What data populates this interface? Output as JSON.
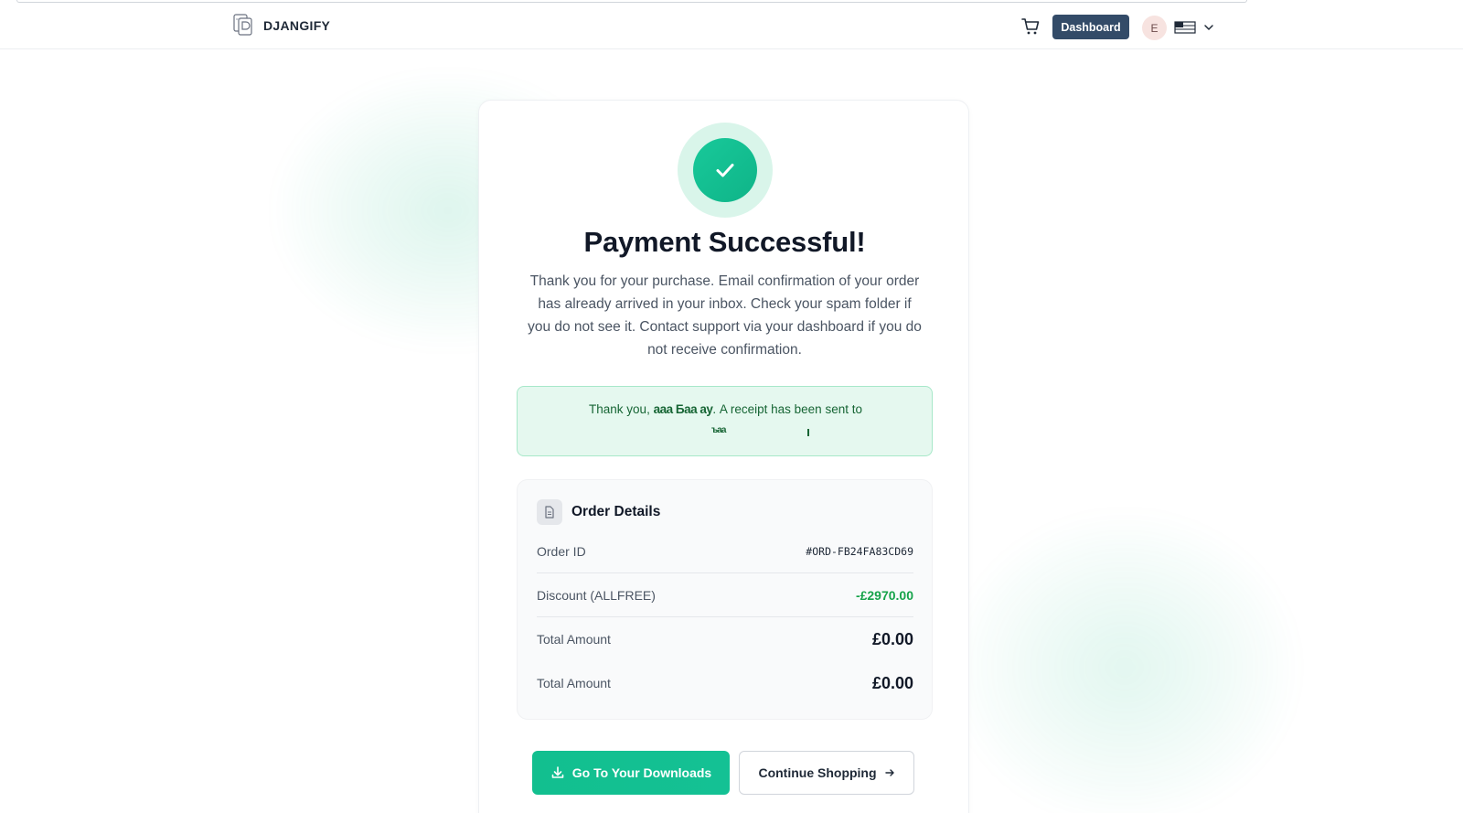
{
  "header": {
    "brand": "DJANGIFY",
    "dashboard_label": "Dashboard",
    "avatar_initial": "E"
  },
  "success": {
    "title": "Payment Successful!",
    "description": "Thank you for your purchase. Email confirmation of your order has already arrived in your inbox. Check your spam folder if you do not see it. Contact support via your dashboard if you do not receive confirmation.",
    "receipt_prefix": "Thank you,",
    "receipt_name_redacted": "ааа Баа ау",
    "receipt_suffix": ". A receipt has been sent to",
    "receipt_email_redacted": "ъаа"
  },
  "order": {
    "title": "Order Details",
    "rows": [
      {
        "label": "Order ID",
        "value": "#ORD-FB24FA83CD69"
      },
      {
        "label": "Discount (ALLFREE)",
        "value": "-£2970.00"
      },
      {
        "label": "Total Amount",
        "value": "£0.00"
      },
      {
        "label": "Total Amount",
        "value": "£0.00"
      }
    ]
  },
  "actions": {
    "downloads_label": "Go To Your Downloads",
    "continue_label": "Continue Shopping"
  },
  "colors": {
    "accent": "#12bf8f",
    "header_button": "#334b68",
    "discount": "#16a34a"
  }
}
